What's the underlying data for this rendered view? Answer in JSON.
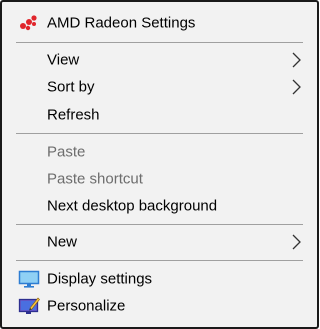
{
  "menu": {
    "items": [
      {
        "label": "AMD Radeon Settings",
        "icon": "amd-radeon-icon"
      },
      {
        "label": "View",
        "submenu": true
      },
      {
        "label": "Sort by",
        "submenu": true
      },
      {
        "label": "Refresh"
      },
      {
        "label": "Paste",
        "disabled": true
      },
      {
        "label": "Paste shortcut",
        "disabled": true
      },
      {
        "label": "Next desktop background"
      },
      {
        "label": "New",
        "submenu": true
      },
      {
        "label": "Display settings",
        "icon": "display-settings-icon"
      },
      {
        "label": "Personalize",
        "icon": "personalize-icon"
      }
    ]
  },
  "colors": {
    "menu_background": "#f2f2f2",
    "border": "#1a1a1a",
    "separator": "#a0a0a0",
    "disabled_text": "#6d6d6d",
    "amd_red": "#e0252b",
    "display_icon_blue": "#2d7dd2"
  }
}
